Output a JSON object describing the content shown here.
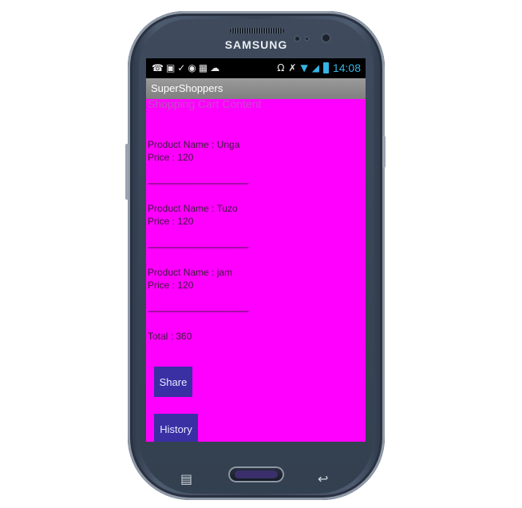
{
  "device": {
    "brand": "SAMSUNG"
  },
  "status_bar": {
    "time": "14:08",
    "icons": [
      "whatsapp-icon",
      "image-icon",
      "check-cloud-icon",
      "bug-icon",
      "app-icon",
      "cloud-icon",
      "headset-icon",
      "mute-icon",
      "wifi-icon",
      "signal-icon",
      "battery-icon"
    ]
  },
  "app": {
    "title": "SuperShoppers"
  },
  "cart": {
    "heading": "Shopping Cart Content",
    "items": [
      {
        "name_line": "Product Name : Unga",
        "price_line": "Price : 120"
      },
      {
        "name_line": "Product Name : Tuzo",
        "price_line": "Price : 120"
      },
      {
        "name_line": "Product Name : jam",
        "price_line": "Price : 120"
      }
    ],
    "divider": "------------------------------------------",
    "total_line": "Total : 360"
  },
  "buttons": {
    "share_label": "Share",
    "history_label": "History"
  },
  "colors": {
    "content_bg": "#ff00ff",
    "button_bg": "#3a2fa3",
    "status_accent": "#35b5e5"
  }
}
